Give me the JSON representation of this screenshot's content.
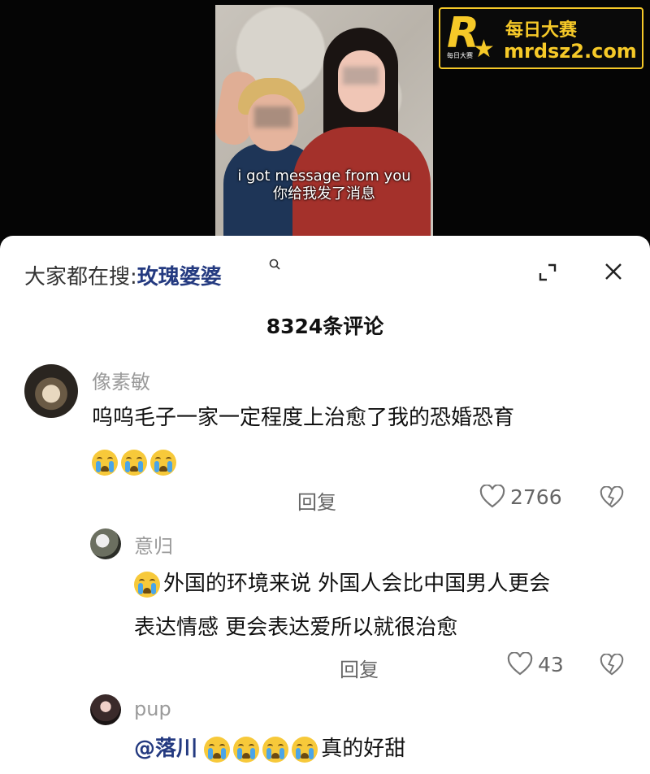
{
  "video": {
    "subtitle_en": "i got message from you",
    "subtitle_zh": "你给我发了消息"
  },
  "watermark": {
    "title": "每日大赛",
    "url": "mrdsz2.com",
    "logo_letter": "R",
    "logo_small": "每日大赛"
  },
  "panel": {
    "search_prefix": "大家都在搜:",
    "search_term": "玫瑰婆婆",
    "comment_count": "8324条评论"
  },
  "comments": [
    {
      "user": "像素敏",
      "text_line1": "呜呜毛子一家一定程度上治愈了我的恐婚恐育",
      "emoji_count": 3,
      "reply_label": "回复",
      "likes": "2766"
    },
    {
      "user": "意归",
      "text_line1": "外国的环境来说 外国人会比中国男人更会",
      "text_line2": "表达情感 更会表达爱所以就很治愈",
      "reply_label": "回复",
      "likes": "43"
    },
    {
      "user": "pup",
      "mention": "@落川",
      "text_suffix": "真的好甜"
    }
  ],
  "icons": {
    "search": "search-icon",
    "expand": "expand-icon",
    "close": "close-icon",
    "like": "heart-icon",
    "dislike": "broken-heart-icon",
    "emoji": "crying-face-icon"
  },
  "colors": {
    "accent": "#243a80",
    "watermark": "#f6c928",
    "emoji": "#f7c93a"
  }
}
